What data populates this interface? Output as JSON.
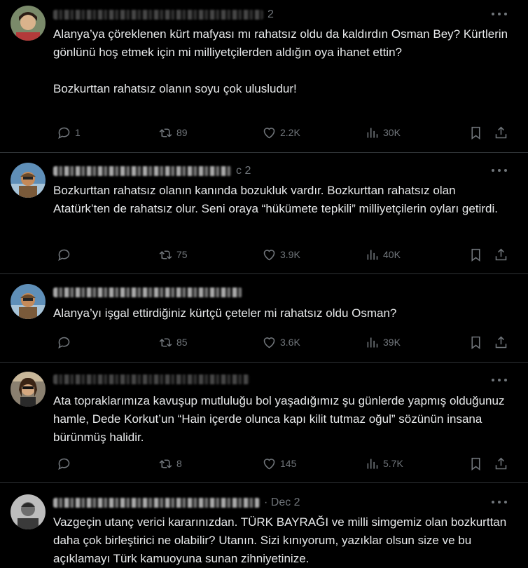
{
  "tweets": [
    {
      "date": "2",
      "text": [
        "Alanya’ya çöreklenen kürt mafyası mı rahatsız oldu da kaldırdın Osman Bey? Kürtlerin gönlünü hoş etmek için mi milliyetçilerden aldığın oya ihanet ettin?",
        "Bozkurttan rahatsız olanın soyu çok ulusludur!"
      ],
      "replies": "1",
      "retweets": "89",
      "likes": "2.2K",
      "views": "30K"
    },
    {
      "date": "c 2",
      "text": [
        "Bozkurttan rahatsız olanın kanında bozukluk vardır. Bozkurttan rahatsız olan Atatürk’ten de rahatsız olur. Seni oraya “hükümete tepkili” milliyetçilerin oyları getirdi."
      ],
      "replies": "",
      "retweets": "75",
      "likes": "3.9K",
      "views": "40K"
    },
    {
      "date": "",
      "text": [
        "Alanya’yı işgal ettirdiğiniz kürtçü çeteler mi rahatsız oldu Osman?"
      ],
      "replies": "",
      "retweets": "85",
      "likes": "3.6K",
      "views": "39K"
    },
    {
      "date": "",
      "text": [
        "Ata topraklarımıza kavuşup mutluluğu bol yaşadığımız şu günlerde yapmış olduğunuz hamle, Dede Korkut’un “Hain içerde olunca kapı kilit tutmaz oğul” sözünün insana bürünmüş halidir."
      ],
      "replies": "",
      "retweets": "8",
      "likes": "145",
      "views": "5.7K"
    },
    {
      "date": "· Dec 2",
      "text": [
        "Vazgeçin utanç verici kararınızdan. TÜRK BAYRAĞI ve milli simgemiz olan bozkurttan daha çok birleştirici ne olabilir? Utanın. Sizi kınıyorum, yazıklar olsun size ve bu açıklamayı Türk kamuoyuna sunan zihniyetinize."
      ],
      "replies": "",
      "retweets": "",
      "likes": "",
      "views": ""
    }
  ],
  "colors": {
    "background": "#000000",
    "text": "#e7e9ea",
    "muted": "#71767b",
    "divider": "#2f3336"
  }
}
